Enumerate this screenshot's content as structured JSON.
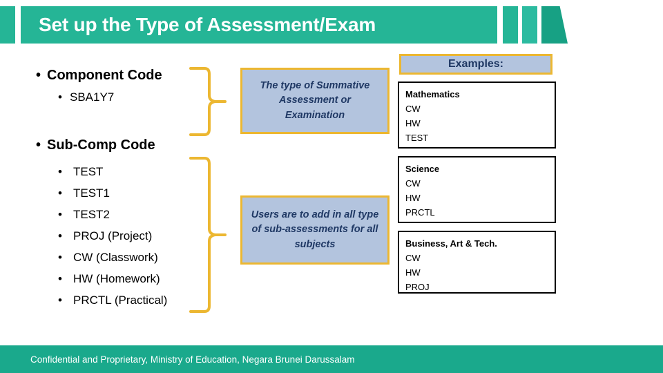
{
  "slide": {
    "title": "Set up the Type of Assessment/Exam",
    "theme": {
      "banner_green": "#25B596",
      "banner_green_dark": "#17A184",
      "footer_green": "#1AA98C",
      "brace_yellow": "#ECB731",
      "callout_fill": "#B3C4DE",
      "callout_text": "#1F3864"
    }
  },
  "left_column": {
    "component": {
      "heading": "Component Code",
      "bullet": "•",
      "items": [
        {
          "label": "SBA1Y7"
        }
      ]
    },
    "sub_component": {
      "heading": "Sub-Comp Code",
      "bullet": "•",
      "items": [
        {
          "label": "TEST"
        },
        {
          "label": "TEST1"
        },
        {
          "label": "TEST2"
        },
        {
          "label": "PROJ (Project)"
        },
        {
          "label": "CW (Classwork)"
        },
        {
          "label": "HW (Homework)"
        },
        {
          "label": "PRCTL (Practical)"
        }
      ]
    }
  },
  "callouts": [
    {
      "text": "The type of Summative Assessment or Examination"
    },
    {
      "text": "Users are to add in all type of sub-assessments for all subjects"
    }
  ],
  "examples": {
    "header": "Examples:",
    "boxes": [
      {
        "subject": "Mathematics",
        "items": [
          "CW",
          "HW",
          "TEST"
        ]
      },
      {
        "subject": "Science",
        "items": [
          "CW",
          "HW",
          "PRCTL"
        ]
      },
      {
        "subject": "Business, Art & Tech.",
        "items": [
          "CW",
          "HW",
          "PROJ"
        ]
      }
    ]
  },
  "footer": {
    "text": "Confidential and Proprietary, Ministry of Education, Negara Brunei Darussalam"
  }
}
